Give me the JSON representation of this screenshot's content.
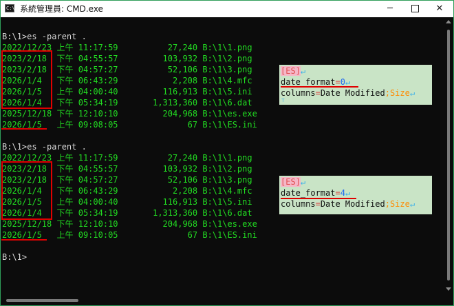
{
  "window": {
    "title": "系統管理員: CMD.exe",
    "icon_label": "C:\\"
  },
  "controls": {
    "min": "─",
    "close": "✕",
    "max_icon": "maximize-icon"
  },
  "console": {
    "block1": {
      "command": "B:\\1>es -parent .",
      "rows": [
        {
          "date": "2022/12/23",
          "ampm": "上午",
          "time": "11:17:59",
          "size": "27,240",
          "path": "B:\\1\\1.png"
        },
        {
          "date": "2023/2/18",
          "ampm": "下午",
          "time": "04:55:57",
          "size": "103,932",
          "path": "B:\\1\\2.png"
        },
        {
          "date": "2023/2/18",
          "ampm": "下午",
          "time": "04:57:27",
          "size": "52,106",
          "path": "B:\\1\\3.png"
        },
        {
          "date": "2026/1/4",
          "ampm": "下午",
          "time": "06:43:29",
          "size": "2,208",
          "path": "B:\\1\\4.mfc"
        },
        {
          "date": "2026/1/5",
          "ampm": "上午",
          "time": "04:00:40",
          "size": "116,913",
          "path": "B:\\1\\5.ini"
        },
        {
          "date": "2026/1/4",
          "ampm": "下午",
          "time": "05:34:19",
          "size": "1,313,360",
          "path": "B:\\1\\6.dat"
        },
        {
          "date": "2025/12/18",
          "ampm": "下午",
          "time": "12:10:10",
          "size": "204,968",
          "path": "B:\\1\\es.exe"
        },
        {
          "date": "2026/1/5",
          "ampm": "上午",
          "time": "09:08:05",
          "size": "67",
          "path": "B:\\1\\ES.ini"
        }
      ]
    },
    "block2": {
      "command": "B:\\1>es -parent .",
      "rows": [
        {
          "date": "2022/12/23",
          "ampm": "上午",
          "time": "11:17:59",
          "size": "27,240",
          "path": "B:\\1\\1.png"
        },
        {
          "date": "2023/2/18",
          "ampm": "下午",
          "time": "04:55:57",
          "size": "103,932",
          "path": "B:\\1\\2.png"
        },
        {
          "date": "2023/2/18",
          "ampm": "下午",
          "time": "04:57:27",
          "size": "52,106",
          "path": "B:\\1\\3.png"
        },
        {
          "date": "2026/1/4",
          "ampm": "下午",
          "time": "06:43:29",
          "size": "2,208",
          "path": "B:\\1\\4.mfc"
        },
        {
          "date": "2026/1/5",
          "ampm": "上午",
          "time": "04:00:40",
          "size": "116,913",
          "path": "B:\\1\\5.ini"
        },
        {
          "date": "2026/1/4",
          "ampm": "下午",
          "time": "05:34:19",
          "size": "1,313,360",
          "path": "B:\\1\\6.dat"
        },
        {
          "date": "2025/12/18",
          "ampm": "下午",
          "time": "12:10:10",
          "size": "204,968",
          "path": "B:\\1\\es.exe"
        },
        {
          "date": "2026/1/5",
          "ampm": "上午",
          "time": "09:10:05",
          "size": "67",
          "path": "B:\\1\\ES.ini"
        }
      ]
    },
    "final_prompt": "B:\\1>"
  },
  "ini_snippets": [
    {
      "section": "[ES]",
      "key1": "date_format",
      "val1": "0",
      "key2": "columns",
      "val2": "Date Modified",
      "extra": ";Size"
    },
    {
      "section": "[ES]",
      "key1": "date_format",
      "val1": "4",
      "key2": "columns",
      "val2": "Date Modified",
      "extra": ";Size"
    }
  ],
  "eol_mark": "↵",
  "colors": {
    "terminal_bg": "#0c0c0c",
    "text_green": "#22dd22",
    "highlight_red": "#e00000",
    "ini_bg": "#c9e4c6"
  }
}
